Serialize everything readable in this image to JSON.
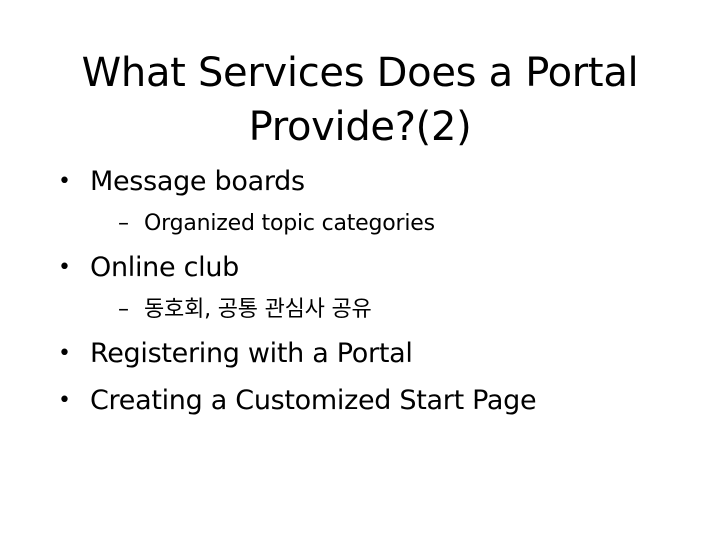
{
  "slide": {
    "title_lines": [
      "What Services Does a Portal",
      "Provide?(2)"
    ],
    "bullet_glyph": "•",
    "dash_glyph": "–",
    "items": [
      {
        "text": "Message boards",
        "subitems": [
          "Organized topic categories"
        ]
      },
      {
        "text": "Online club",
        "subitems": [
          "동호회, 공통 관심사 공유"
        ]
      },
      {
        "text": "Registering with a Portal",
        "subitems": []
      },
      {
        "text": "Creating a Customized Start Page",
        "subitems": []
      }
    ]
  }
}
